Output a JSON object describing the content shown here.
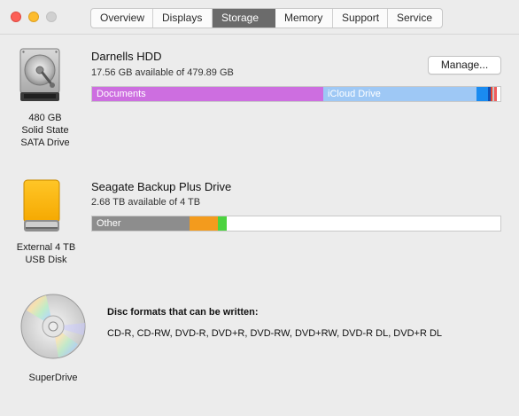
{
  "window": {
    "tabs": [
      "Overview",
      "Displays",
      "Storage",
      "Memory",
      "Support",
      "Service"
    ],
    "active_tab": "Storage"
  },
  "drives": {
    "hdd": {
      "icon": "hard-drive-icon",
      "caption": [
        "480 GB",
        "Solid State",
        "SATA Drive"
      ],
      "name": "Darnells HDD",
      "available": "17.56 GB available of 479.89 GB",
      "manage_label": "Manage...",
      "segments": [
        {
          "label": "Documents",
          "fraction": 0.604,
          "color": "#cd6ee0"
        },
        {
          "label": "iCloud Drive",
          "fraction": 0.4,
          "color": "#9ec8f5"
        }
      ]
    },
    "seagate": {
      "icon": "external-drive-icon",
      "caption": [
        "External 4 TB",
        "USB Disk"
      ],
      "name": "Seagate Backup Plus Drive",
      "available": "2.68 TB available of 4 TB",
      "segments": [
        {
          "label": "Other",
          "fraction": 0.237,
          "color": "#8d8d8d"
        },
        {
          "label": "",
          "fraction": 0.071,
          "color": "#f39b1d"
        },
        {
          "label": "",
          "fraction": 0.025,
          "color": "#4cd33f"
        }
      ]
    },
    "superdrive": {
      "icon": "optical-disc-icon",
      "caption": [
        "SuperDrive"
      ],
      "disc_title": "Disc formats that can be written:",
      "disc_formats": "CD-R, CD-RW, DVD-R, DVD+R, DVD-RW, DVD+RW, DVD-R DL, DVD+R DL"
    }
  }
}
